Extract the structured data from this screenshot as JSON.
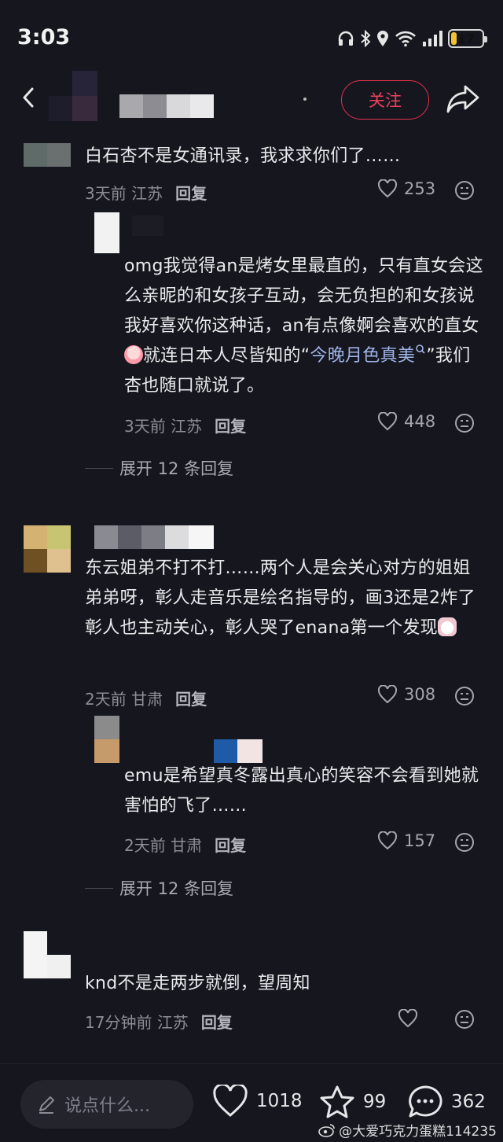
{
  "status": {
    "time": "3:03",
    "battery": "17",
    "battery_level": 0.17
  },
  "header": {
    "follow_label": "关注"
  },
  "comments": [
    {
      "text": "白石杏不是女通讯录，我求求你们了……",
      "time": "3天前",
      "location": "江苏",
      "reply_label": "回复",
      "likes": "253",
      "replies": [
        {
          "text_parts": [
            "omg我觉得an是烤女里最直的，只有直女会这么亲昵的和女孩子互动，会无负担的和女孩说我好喜欢你这种话，an有点像婀会喜欢的直女",
            "就连日本人尽皆知的“",
            "今晚月色真美",
            "”我们杏也随口就说了。"
          ],
          "time": "3天前",
          "location": "江苏",
          "reply_label": "回复",
          "likes": "448"
        }
      ],
      "expand_label": "展开 12 条回复"
    },
    {
      "text": "东云姐弟不打不打……两个人是会关心对方的姐姐弟弟呀，彰人走音乐是绘名指导的，画3还是2炸了彰人也主动关心，彰人哭了enana第一个发现",
      "time": "2天前",
      "location": "甘肃",
      "reply_label": "回复",
      "likes": "308",
      "replies": [
        {
          "text": "emu是希望真冬露出真心的笑容不会看到她就害怕的飞了……",
          "time": "2天前",
          "location": "甘肃",
          "reply_label": "回复",
          "likes": "157"
        }
      ],
      "expand_label": "展开 12 条回复"
    },
    {
      "text": "knd不是走两步就倒，望周知",
      "time": "17分钟前",
      "location": "江苏",
      "reply_label": "回复",
      "likes": ""
    }
  ],
  "bottom": {
    "input_placeholder": "说点什么...",
    "likes": "1018",
    "favorites": "99",
    "comments": "362"
  },
  "watermark": "@大爱巧克力蛋糕114235",
  "colors": {
    "background": "#16161e",
    "accent": "#e2324a",
    "link": "#9fb5e8"
  },
  "icons": [
    "back-icon",
    "share-icon",
    "heart-icon",
    "dislike-icon",
    "pencil-icon",
    "star-icon",
    "comment-bubble-icon",
    "weibo-icon",
    "headphones-icon",
    "bluetooth-icon",
    "location-icon",
    "wifi-icon",
    "signal-icon",
    "battery-icon"
  ]
}
